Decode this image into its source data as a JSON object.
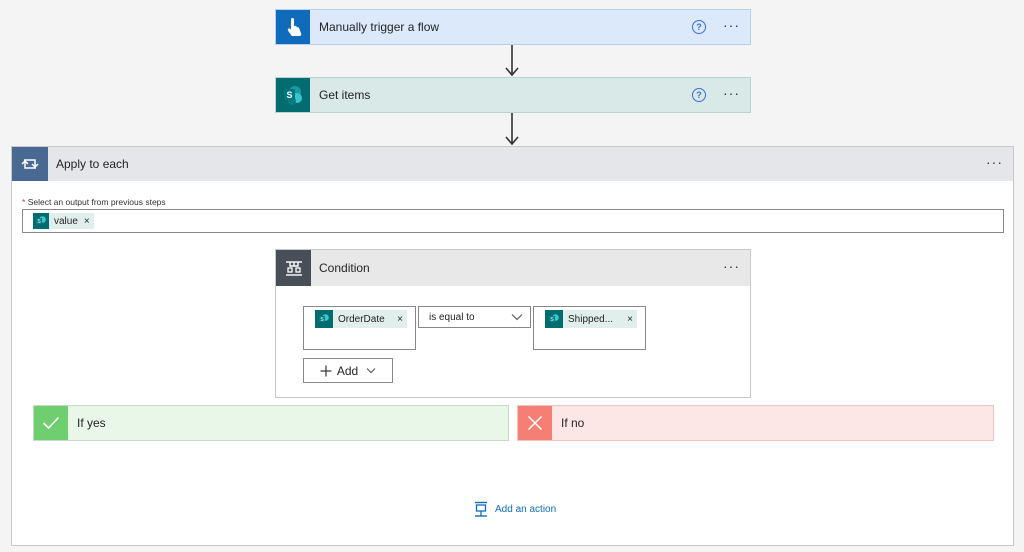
{
  "trigger": {
    "title": "Manually trigger a flow",
    "help": "?",
    "menu": "···"
  },
  "get_items": {
    "title": "Get items",
    "help": "?",
    "menu": "···"
  },
  "apply": {
    "title": "Apply to each",
    "menu": "···",
    "required_mark": "*",
    "output_label": "Select an output from previous steps",
    "token_label": "value",
    "token_remove": "×"
  },
  "condition": {
    "title": "Condition",
    "menu": "···",
    "left_token": "OrderDate",
    "left_remove": "×",
    "operator": "is equal to",
    "right_token": "Shipped...",
    "right_remove": "×",
    "add_label": "Add"
  },
  "if_yes": {
    "label": "If yes"
  },
  "if_no": {
    "label": "If no"
  },
  "add_action": {
    "label": "Add an action"
  },
  "colors": {
    "trigger_accent": "#0f6cbd",
    "trigger_bg": "#dbe9fb",
    "sharepoint": "#036c70",
    "sharepoint_bg": "#d9e9e7",
    "loop_accent": "#486991",
    "condition_accent": "#484f58",
    "yes_accent": "#6fce6f",
    "yes_bg": "#e9f7e9",
    "no_accent": "#f57f75",
    "no_bg": "#fde7e6",
    "link": "#0f6cbd"
  },
  "icons": [
    "touch-icon",
    "sharepoint-icon",
    "loop-icon",
    "condition-icon",
    "check-icon",
    "close-icon",
    "add-action-icon",
    "help-icon",
    "more-icon",
    "chevron-down-icon",
    "plus-icon"
  ]
}
